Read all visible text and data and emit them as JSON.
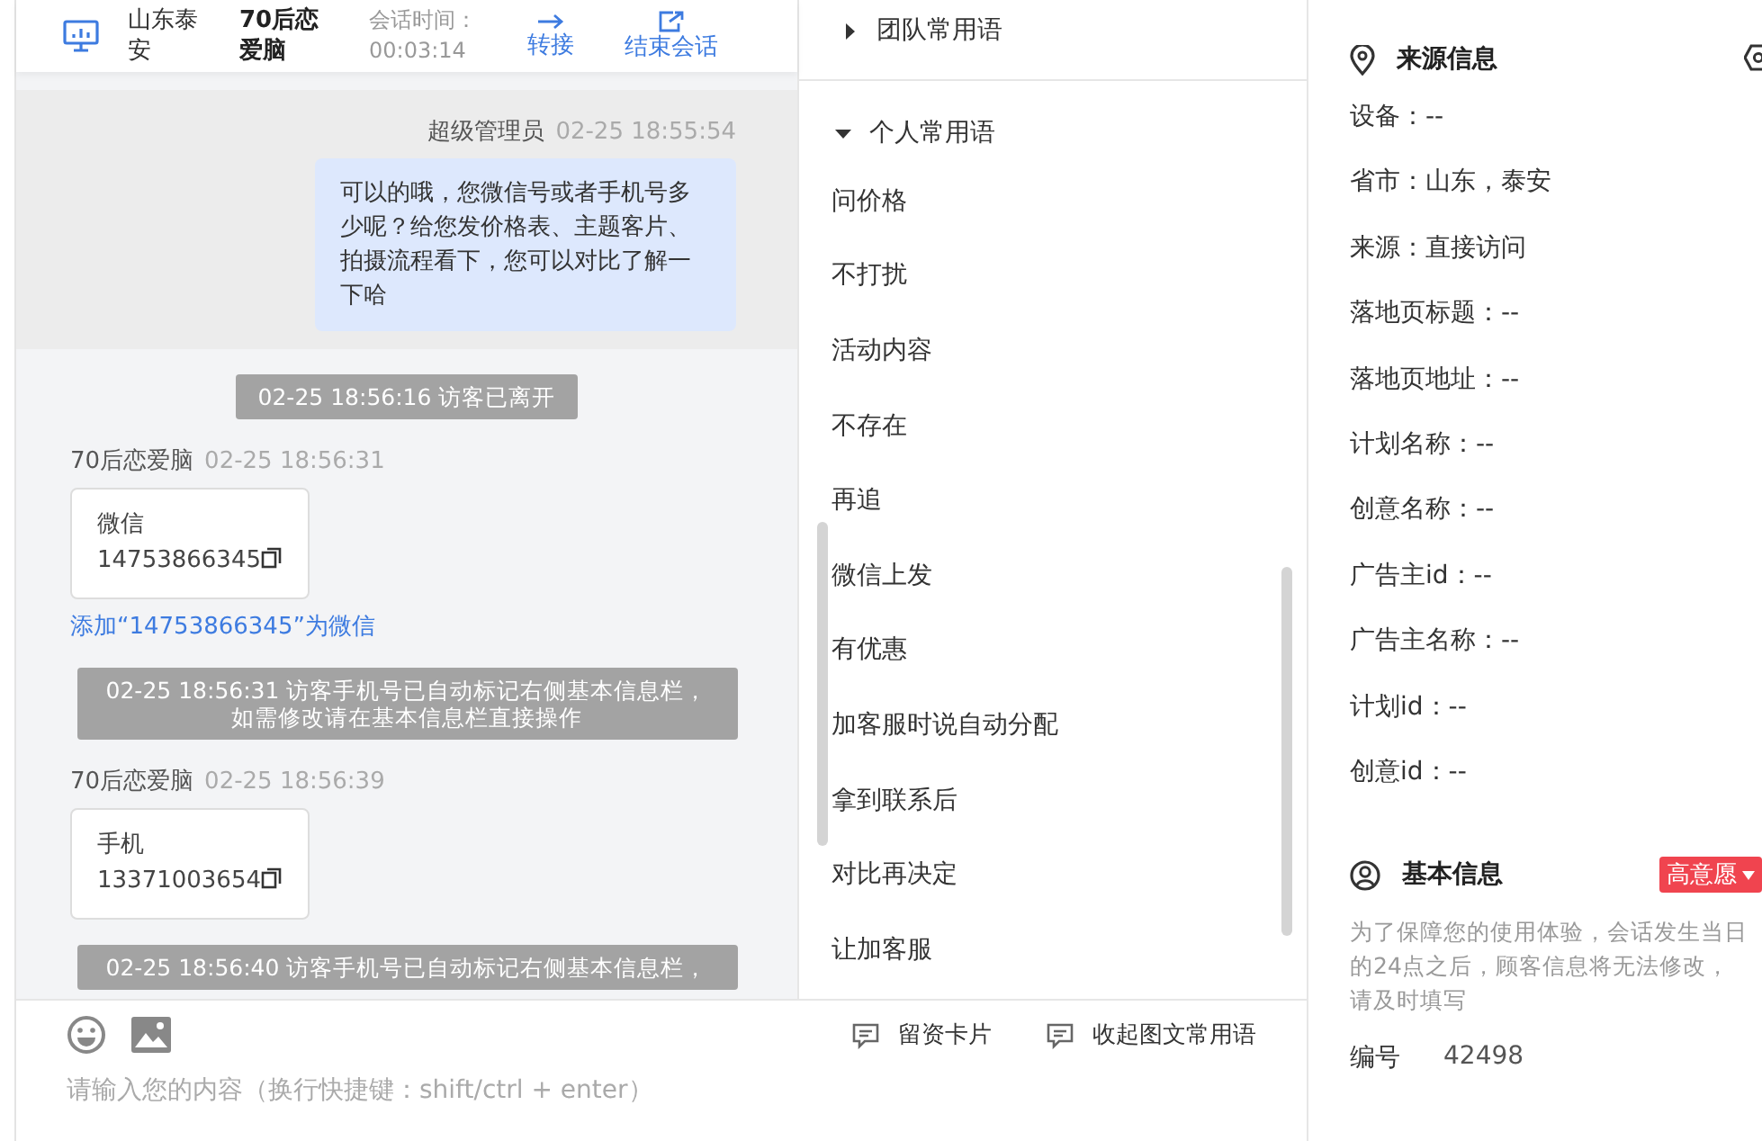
{
  "header": {
    "location": "山东泰安",
    "visitor": "70后恋爱脑",
    "duration_label": "会话时间：",
    "duration": "00:03:14",
    "actions": [
      {
        "kind": "transfer",
        "label": "转接"
      },
      {
        "kind": "end",
        "label": "结束会话"
      }
    ]
  },
  "chat": {
    "messages": [
      {
        "kind": "agent",
        "sender": "超级管理员",
        "time": "02-25 18:55:54",
        "text": "可以的哦，您微信号或者手机号多少呢？给您发价格表、主题客片、拍摄流程看下，您可以对比了解一下哈"
      },
      {
        "kind": "system",
        "lines": [
          "02-25 18:56:16 访客已离开"
        ]
      },
      {
        "kind": "visitor_card",
        "sender": "70后恋爱脑",
        "time": "02-25 18:56:31",
        "card_title": "微信",
        "card_value": "14753866345",
        "link": "添加“14753866345”为微信"
      },
      {
        "kind": "system",
        "lines": [
          "02-25 18:56:31 访客手机号已自动标记右侧基本信息栏，",
          "如需修改请在基本信息栏直接操作"
        ]
      },
      {
        "kind": "visitor_card",
        "sender": "70后恋爱脑",
        "time": "02-25 18:56:39",
        "card_title": "手机",
        "card_value": "13371003654"
      },
      {
        "kind": "system",
        "lines": [
          "02-25 18:56:40 访客手机号已自动标记右侧基本信息栏，"
        ]
      }
    ]
  },
  "phrases": {
    "groups": [
      {
        "title": "团队常用语",
        "expanded": false
      },
      {
        "title": "个人常用语",
        "expanded": true,
        "items": [
          "问价格",
          "不打扰",
          "活动内容",
          "不存在",
          "再追",
          "微信上发",
          "有优惠",
          "加客服时说自动分配",
          "拿到联系后",
          "对比再决定",
          "让加客服"
        ]
      }
    ]
  },
  "composer": {
    "tools": [
      "留资卡片",
      "收起图文常用语"
    ],
    "placeholder": "请输入您的内容（换行快捷键：shift/ctrl + enter）"
  },
  "source_info": {
    "title": "来源信息",
    "fields": [
      "设备：--",
      "省市：山东，泰安",
      "来源：直接访问",
      "落地页标题：--",
      "落地页地址：--",
      "计划名称：--",
      "创意名称：--",
      "广告主id：--",
      "广告主名称：--",
      "计划id：--",
      "创意id：--"
    ]
  },
  "basic_info": {
    "title": "基本信息",
    "intent_tag": "高意愿",
    "notice": "为了保障您的使用体验，会话发生当日的24点之后，顾客信息将无法修改，请及时填写",
    "id_label": "编号",
    "id_value": "42498"
  }
}
